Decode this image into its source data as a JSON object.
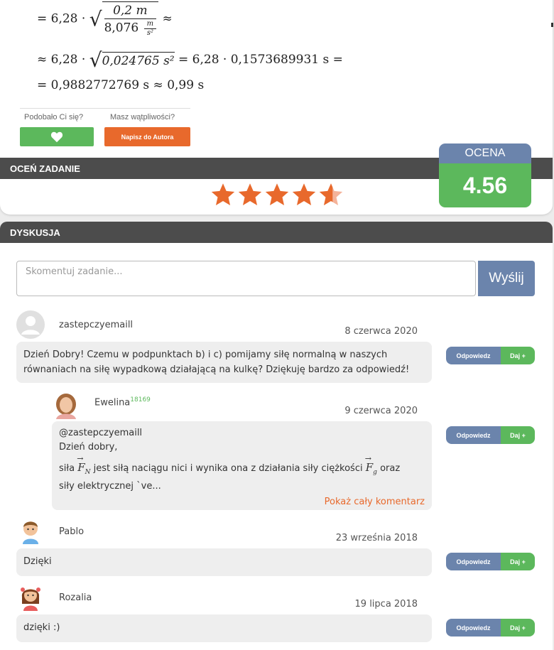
{
  "math": {
    "line1_prefix": "= 6,28 ·",
    "line1_num": "0,2 m",
    "line1_den": "8,076",
    "line1_unit_num": "m",
    "line1_unit_den": "s²",
    "line1_suffix": "≈",
    "line2_prefix": "≈ 6,28 ·",
    "line2_sqrt": "0,024765 s²",
    "line2_suffix": "= 6,28 · 0,1573689931 s =",
    "line3": "= 0,9882772769 s ≈ 0,99 s"
  },
  "feedback": {
    "liked_label": "Podobało Ci się?",
    "doubt_label": "Masz wątpliwości?",
    "like_icon": "heart-icon",
    "author_button": "Napisz do Autora"
  },
  "rating": {
    "bar_title": "OCEŃ ZADANIE",
    "stars_value": 4.56,
    "stars_max": 5,
    "star_color": "#e8692c",
    "box_title": "OCENA",
    "box_value": "4.56"
  },
  "discussion": {
    "bar_title": "DYSKUSJA",
    "input_placeholder": "Skomentuj zadanie...",
    "send_button": "Wyślij",
    "reply_label": "Odpowiedz",
    "give_label": "Daj +",
    "comments": [
      {
        "user": "zastepczyemaill",
        "date": "8 czerwca 2020",
        "text": "Dzień Dobry! Czemu w podpunktach b) i c) pomijamy siłę normalną w naszych równaniach na siłę wypadkową działającą na kulkę? Dziękuję bardzo za odpowiedź!"
      },
      {
        "user": "Ewelina",
        "points": "18169",
        "date": "9 czerwca 2020",
        "line1": "@zastepczyemaill",
        "line2": "Dzień dobry,",
        "line3a": "siła",
        "vec1": "F",
        "vec1_sub": "N",
        "line3b": "jest siłą naciągu nici i wynika ona z działania siły ciężkości",
        "vec2": "F",
        "vec2_sub": "g",
        "line3c": "oraz",
        "line4": "siły elektrycznej `ve...",
        "show_more": "Pokaż cały komentarz"
      },
      {
        "user": "Pablo",
        "date": "23 września 2018",
        "text": "Dzięki"
      },
      {
        "user": "Rozalia",
        "date": "19 lipca 2018",
        "text": "dzięki :)"
      }
    ]
  },
  "colors": {
    "green": "#5cb85c",
    "orange": "#e8692c",
    "blue": "#6b84ac",
    "dark_bar": "#4c4c4c"
  }
}
